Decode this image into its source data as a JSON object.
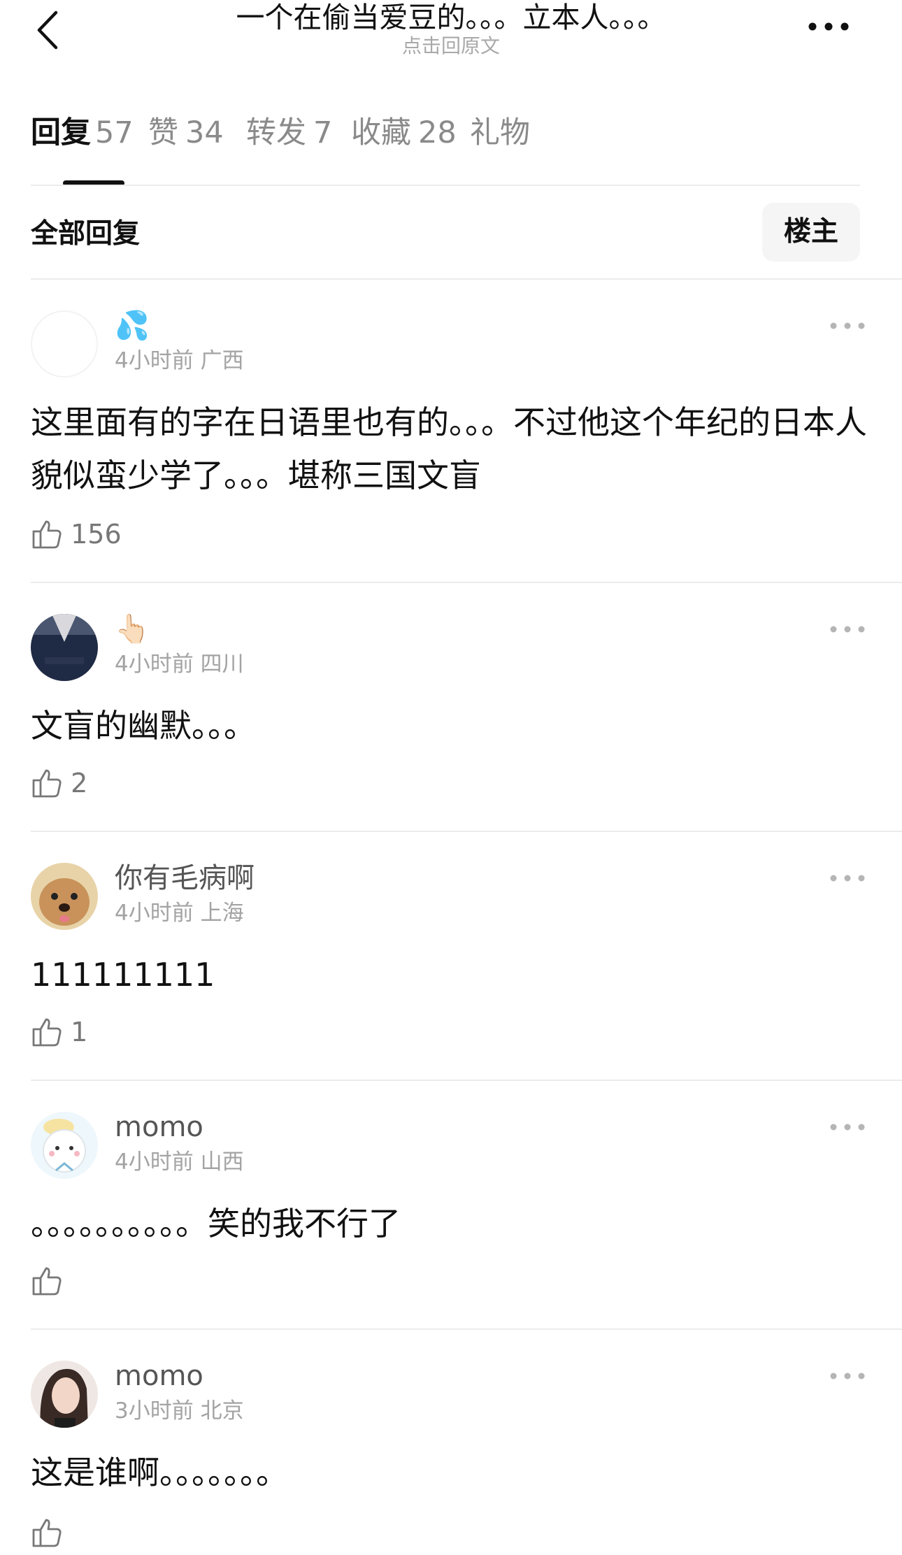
{
  "header": {
    "title": "一个在偷当爱豆的。。。立本人。。。",
    "subtitle": "点击回原文"
  },
  "tabs": [
    {
      "name": "回复",
      "count": "57",
      "active": true
    },
    {
      "name": "赞",
      "count": "34",
      "active": false
    },
    {
      "name": "转发",
      "count": "7",
      "active": false
    },
    {
      "name": "收藏",
      "count": "28",
      "active": false
    },
    {
      "name": "礼物",
      "count": "",
      "active": false
    }
  ],
  "filter": {
    "label": "全部回复",
    "op_button": "楼主"
  },
  "comments": [
    {
      "name": "💦",
      "time": "4小时前",
      "location": "广西",
      "text": "这里面有的字在日语里也有的。。。不过他这个年纪的日本人貌似蛮少学了。。。堪称三国文盲",
      "likes": "156"
    },
    {
      "name": "👆🏻",
      "time": "4小时前",
      "location": "四川",
      "text": "文盲的幽默。。。",
      "likes": "2"
    },
    {
      "name": "你有毛病啊",
      "time": "4小时前",
      "location": "上海",
      "text": "111111111",
      "likes": "1"
    },
    {
      "name": "momo",
      "time": "4小时前",
      "location": "山西",
      "text": "。。。。。。。。。。笑的我不行了",
      "likes": ""
    },
    {
      "name": "momo",
      "time": "3小时前",
      "location": "北京",
      "text": "这是谁啊。。。。。。。",
      "likes": ""
    }
  ],
  "icons": {
    "back": "chevron-left-icon",
    "more": "more-horizontal-icon",
    "like": "thumbs-up-icon"
  }
}
